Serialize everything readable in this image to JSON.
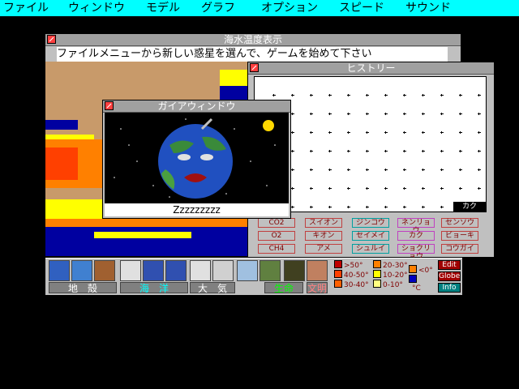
{
  "menu": [
    "ファイル",
    "ウィンドウ",
    "モデル",
    "グラフ",
    "オプション",
    "スピード",
    "サウンド"
  ],
  "windows": {
    "sea_temp": {
      "title": "海水温度表示"
    },
    "history": {
      "title": "ヒストリー",
      "label": "カク"
    },
    "gaia": {
      "title": "ガイアウィンドウ",
      "sleep_text": "Zzzzzzzzz"
    }
  },
  "message": "ファイルメニューから新しい惑星を選んで、ゲームを始めて下さい",
  "history_buttons": [
    [
      "CO2",
      "スイオン",
      "ジンコウ",
      "ネンリョウ",
      "センソウ"
    ],
    [
      "O2",
      "キオン",
      "セイメイ",
      "カク",
      "ビョーキ"
    ],
    [
      "CH4",
      "アメ",
      "シュルイ",
      "ショクリョウ",
      "コウガイ"
    ]
  ],
  "groups": {
    "geosphere": "地　殻",
    "hydrosphere": "海　洋",
    "atmosphere": "大　気",
    "biosphere": "生命",
    "civilization": "文明"
  },
  "legend": {
    "items": [
      ">50°",
      "20-30°",
      "<0°",
      "40-50°",
      "10-20°",
      "30-40°",
      "0-10°"
    ],
    "unit": "°C"
  },
  "side_buttons": [
    "Edit",
    "Globe",
    "Info"
  ],
  "colors": {
    "menubar": "#00ffff",
    "sea_deep": "#0000a0",
    "sea_warm": "#ff8000",
    "sea_hot": "#ff4000",
    "land": "#c89a6a",
    "yellow": "#ffff00"
  },
  "icons": [
    "world-icon",
    "continental-drift-icon",
    "volcano-icon",
    "ocean-current-icon",
    "sea-temperature-icon",
    "air-current-icon",
    "air-temperature-icon",
    "cloud-icon",
    "life-icon",
    "biome-icon",
    "insect-icon",
    "civilization-icon"
  ]
}
